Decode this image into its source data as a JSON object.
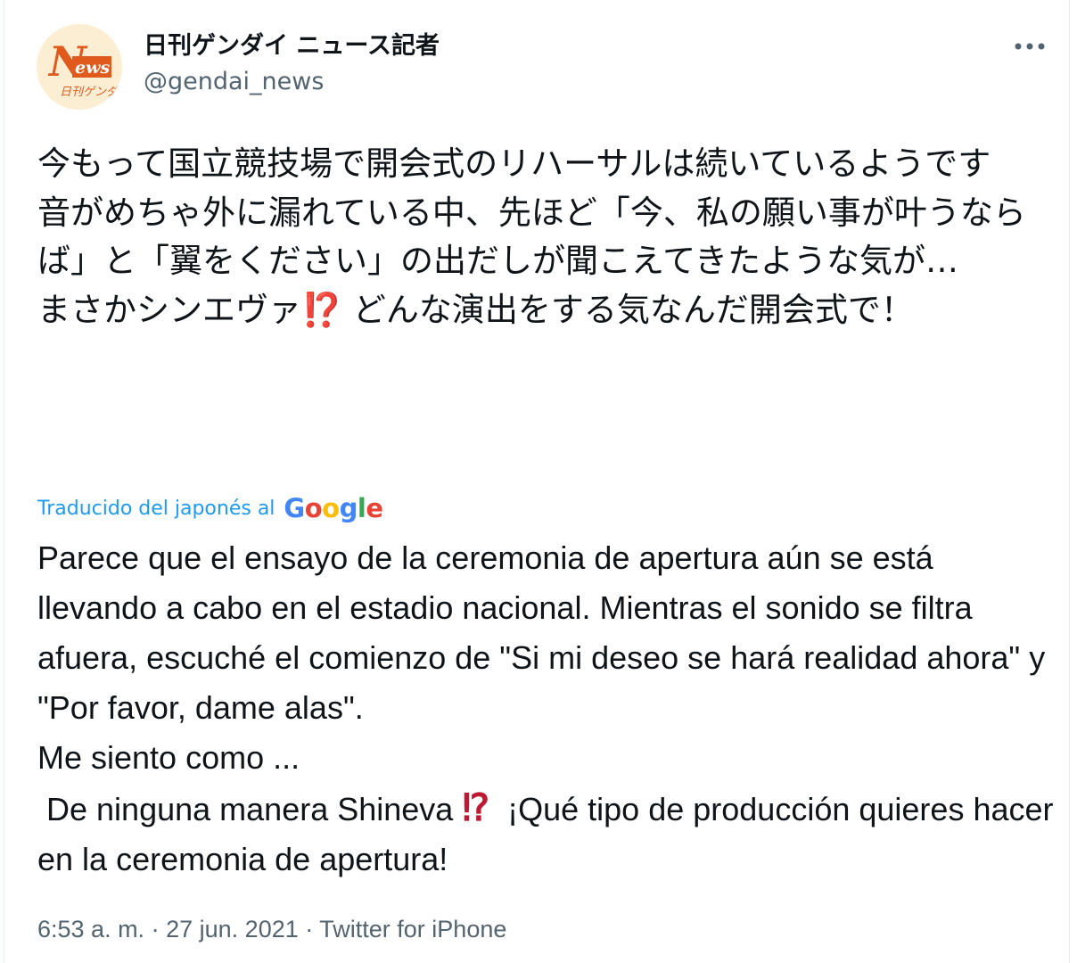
{
  "author": {
    "display_name": "日刊ゲンダイ ニュース記者",
    "handle": "@gendai_news",
    "avatar_text": "News",
    "avatar_subtext": "日刊ゲンダイ"
  },
  "tweet": {
    "text": "今もって国立競技場で開会式のリハーサルは続いているようです\n音がめちゃ外に漏れている中、先ほど「今、私の願い事が叶うならば」と「翼をください」の出だしが聞こえてきたような気が…\nまさかシンエヴァ⁉️ どんな演出をする気なんだ開会式で！",
    "translated_label": "Traducido del japonés al",
    "translator": "Google",
    "translation_part1": "Parece que el ensayo de la ceremonia de apertura aún se está llevando a cabo en el estadio nacional. Mientras el sonido se filtra afuera, escuché el comienzo de \"Si mi deseo se hará realidad ahora\" y \"Por favor, dame alas\".\nMe siento como ...\n De ninguna manera Shineva ",
    "translation_emoji": "⁉",
    "translation_part2": "  ¡Qué tipo de producción quieres hacer en la ceremonia de apertura!",
    "time": "6:53 a. m.",
    "date": "27 jun. 2021",
    "source": "Twitter for iPhone",
    "separator": "·"
  },
  "colors": {
    "link_blue": "#1d9bf0",
    "secondary_text": "#536471",
    "emoji_red": "#be1931"
  },
  "icons": {
    "more": "more-horizontal-icon"
  }
}
